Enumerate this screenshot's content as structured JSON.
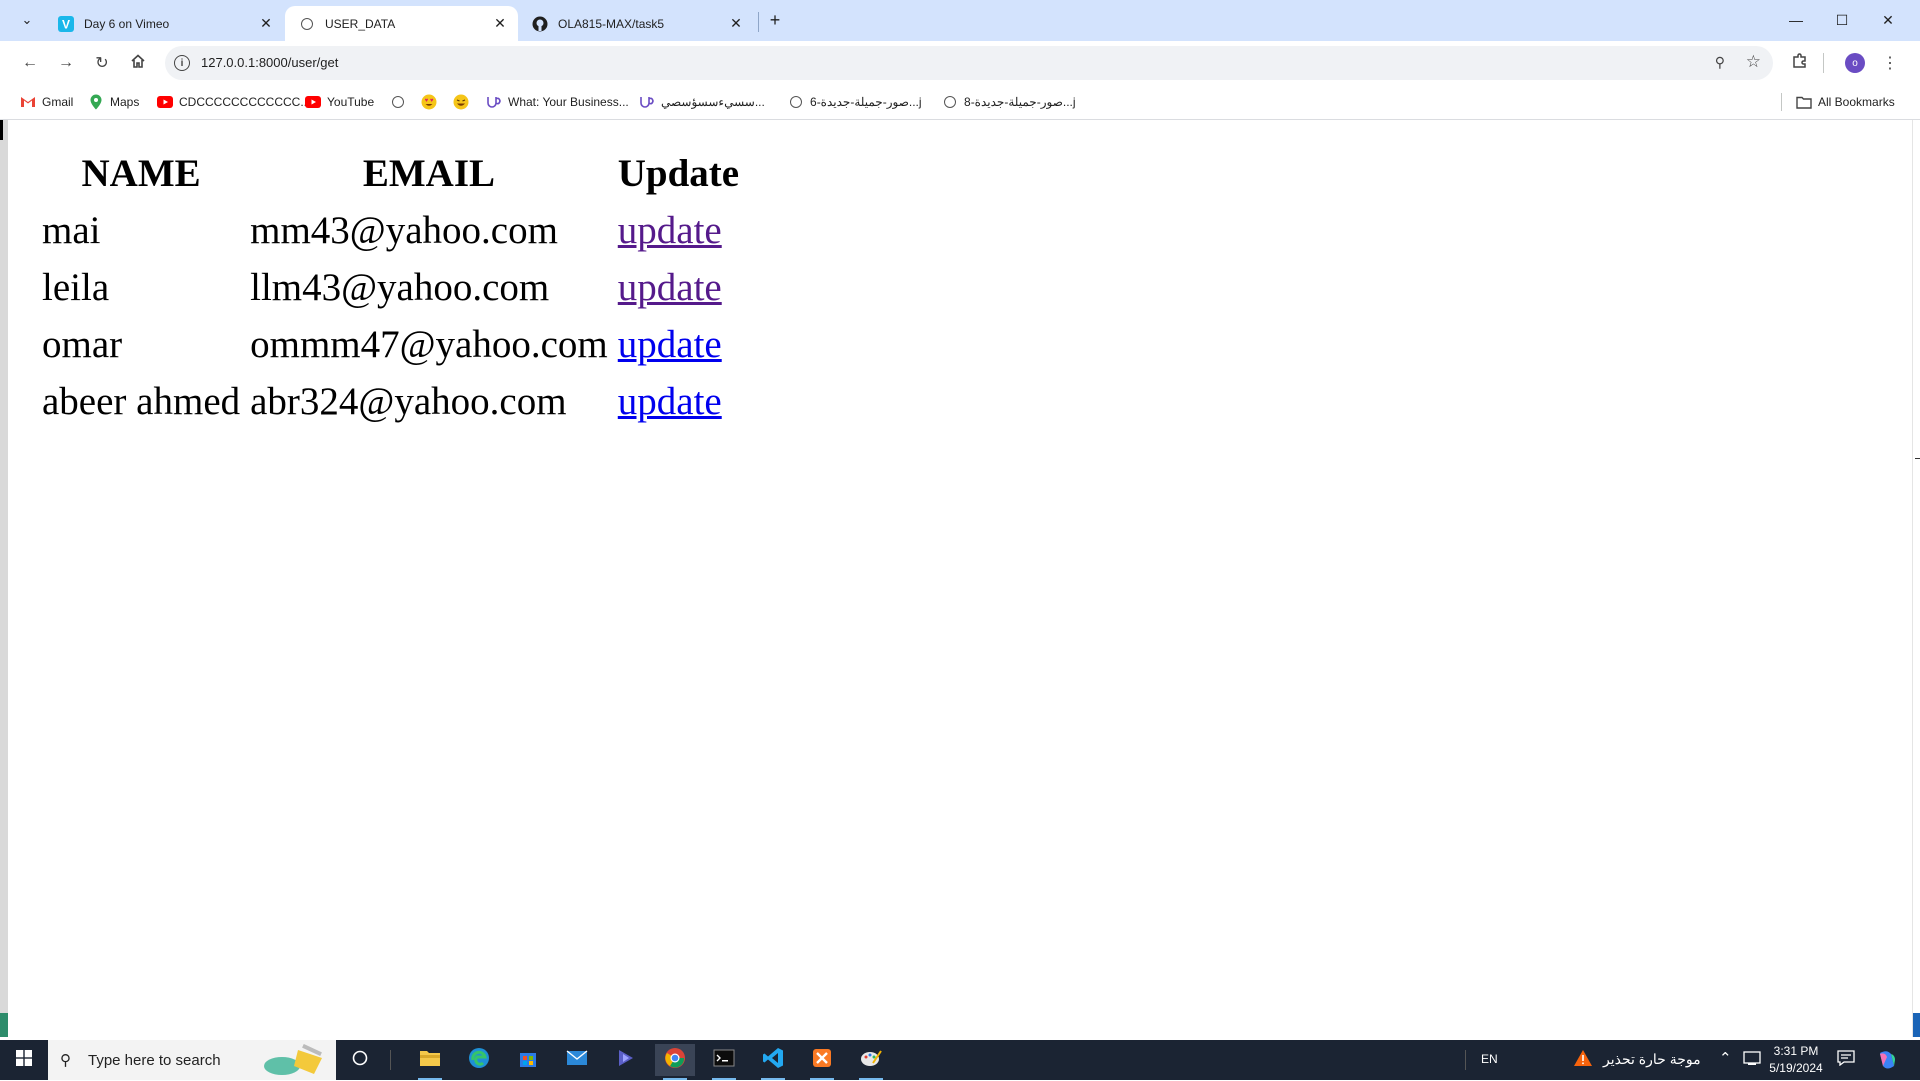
{
  "browser": {
    "tabs": [
      {
        "title": "Day 6 on Vimeo",
        "icon": "vimeo-icon",
        "active": false
      },
      {
        "title": "USER_DATA",
        "icon": "globe-icon",
        "active": true
      },
      {
        "title": "OLA815-MAX/task5",
        "icon": "github-icon",
        "active": false
      }
    ],
    "new_tab_glyph": "+",
    "address_bar": {
      "url": "127.0.0.1:8000/user/get"
    },
    "profile_initial": "o",
    "bookmarks": [
      {
        "label": "Gmail",
        "icon": "gmail-icon"
      },
      {
        "label": "Maps",
        "icon": "maps-icon"
      },
      {
        "label": "CDCCCCCCCCCCCC...",
        "icon": "youtube-icon"
      },
      {
        "label": "YouTube",
        "icon": "youtube-icon"
      },
      {
        "label": "",
        "icon": "globe-icon"
      },
      {
        "label": "",
        "icon": "emoji-heart-eyes-icon"
      },
      {
        "label": "",
        "icon": "emoji-laugh-icon"
      },
      {
        "label": "What: Your Business...",
        "icon": "upwork-icon"
      },
      {
        "label": "سسيءسسؤسصي...",
        "icon": "upwork-icon"
      },
      {
        "label": "صور-جميلة-جديدة-6...j",
        "icon": "globe-icon"
      },
      {
        "label": "صور-جميلة-جديدة-8...j",
        "icon": "globe-icon"
      }
    ],
    "all_bookmarks_label": "All Bookmarks"
  },
  "page": {
    "table": {
      "headers": [
        "NAME",
        "EMAIL",
        "Update"
      ],
      "rows": [
        {
          "name": "mai",
          "email": "mm43@yahoo.com",
          "link": "update",
          "visited": true
        },
        {
          "name": "leila",
          "email": "llm43@yahoo.com",
          "link": "update",
          "visited": true
        },
        {
          "name": "omar",
          "email": "ommm47@yahoo.com",
          "link": "update",
          "visited": false
        },
        {
          "name": "abeer ahmed",
          "email": "abr324@yahoo.com",
          "link": "update",
          "visited": false
        }
      ]
    }
  },
  "taskbar": {
    "search_placeholder": "Type here to search",
    "language": "EN",
    "weather_alert": "موجة حارة تحذير",
    "time": "3:31 PM",
    "date": "5/19/2024"
  },
  "colors": {
    "tabstrip": "#d3e3fd",
    "visited_link": "#551a8b",
    "unvisited_link": "#0000ee",
    "taskbar": "#1b2433"
  }
}
